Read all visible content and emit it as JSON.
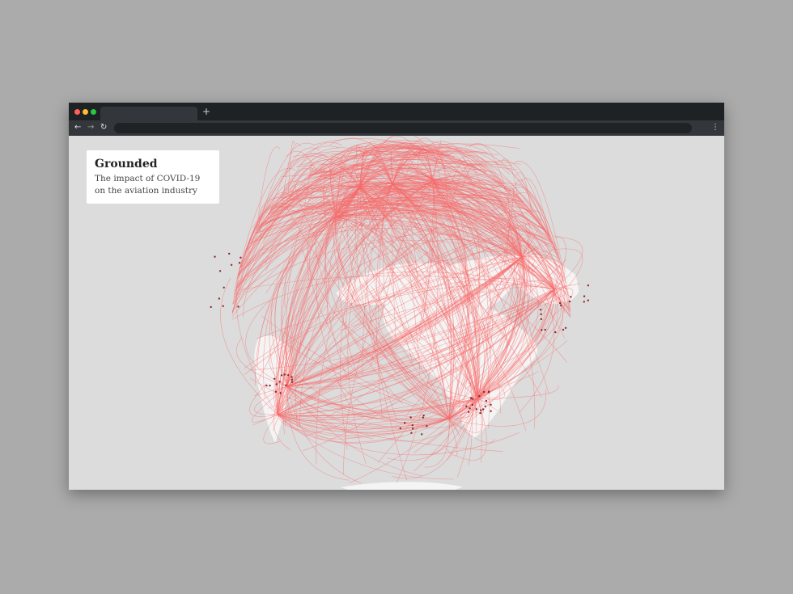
{
  "browser": {
    "controls": {
      "close_color": "#ff5f57",
      "minimize_color": "#febc2e",
      "maximize_color": "#28c840"
    },
    "new_tab_label": "+",
    "nav": {
      "back": "←",
      "forward": "→",
      "reload": "↻",
      "menu": "⋮"
    },
    "address_value": ""
  },
  "page": {
    "title": "Grounded",
    "subtitle": "The impact of COVID-19 on the aviation industry"
  },
  "map": {
    "route_color": "#f76a6a",
    "airport_color": "#8a2a2a",
    "land_color": "#f4f4f4",
    "ocean_color": "#dcdcdc"
  }
}
